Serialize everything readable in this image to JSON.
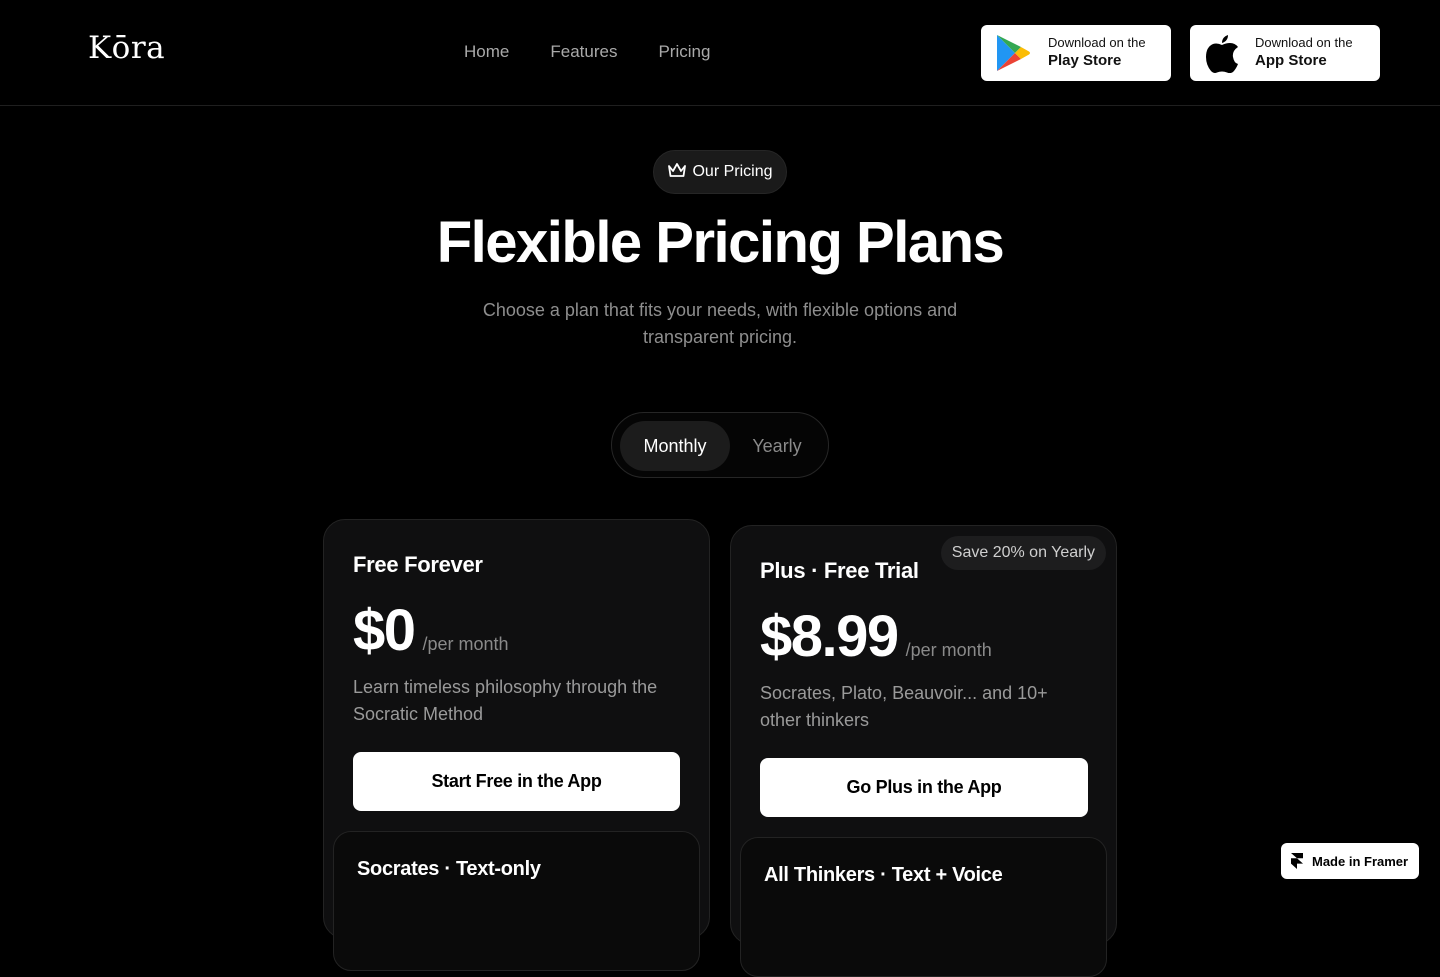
{
  "header": {
    "logo": "Kōra",
    "nav": [
      {
        "label": "Home"
      },
      {
        "label": "Features"
      },
      {
        "label": "Pricing"
      }
    ],
    "play_store": {
      "small": "Download on the",
      "big": "Play Store",
      "icon": "google-play-icon"
    },
    "app_store": {
      "small": "Download on the",
      "big": "App Store",
      "icon": "apple-icon"
    }
  },
  "hero": {
    "badge_icon": "crown-icon",
    "badge": "Our Pricing",
    "title": "Flexible Pricing Plans",
    "subtitle": "Choose a plan that fits your needs, with flexible options and transparent pricing."
  },
  "billing_toggle": {
    "options": [
      "Monthly",
      "Yearly"
    ],
    "selected": "Monthly"
  },
  "plans": [
    {
      "name": "Free Forever",
      "price": "$0",
      "period": "/per month",
      "description": "Learn timeless philosophy through the Socratic Method",
      "cta": "Start Free in the App",
      "features_title": "Socrates · Text-only"
    },
    {
      "name": "Plus · Free Trial",
      "badge": "Save 20% on Yearly",
      "price": "$8.99",
      "period": "/per month",
      "description": "Socrates, Plato, Beauvoir... and 10+ other thinkers",
      "cta": "Go Plus in the App",
      "features_title": "All Thinkers · Text + Voice"
    }
  ],
  "framer_badge": {
    "label": "Made in Framer",
    "icon": "framer-icon"
  },
  "colors": {
    "background": "#000000",
    "card": "#0f0f10",
    "muted_text": "#8e8e8e",
    "button": "#ffffff"
  }
}
